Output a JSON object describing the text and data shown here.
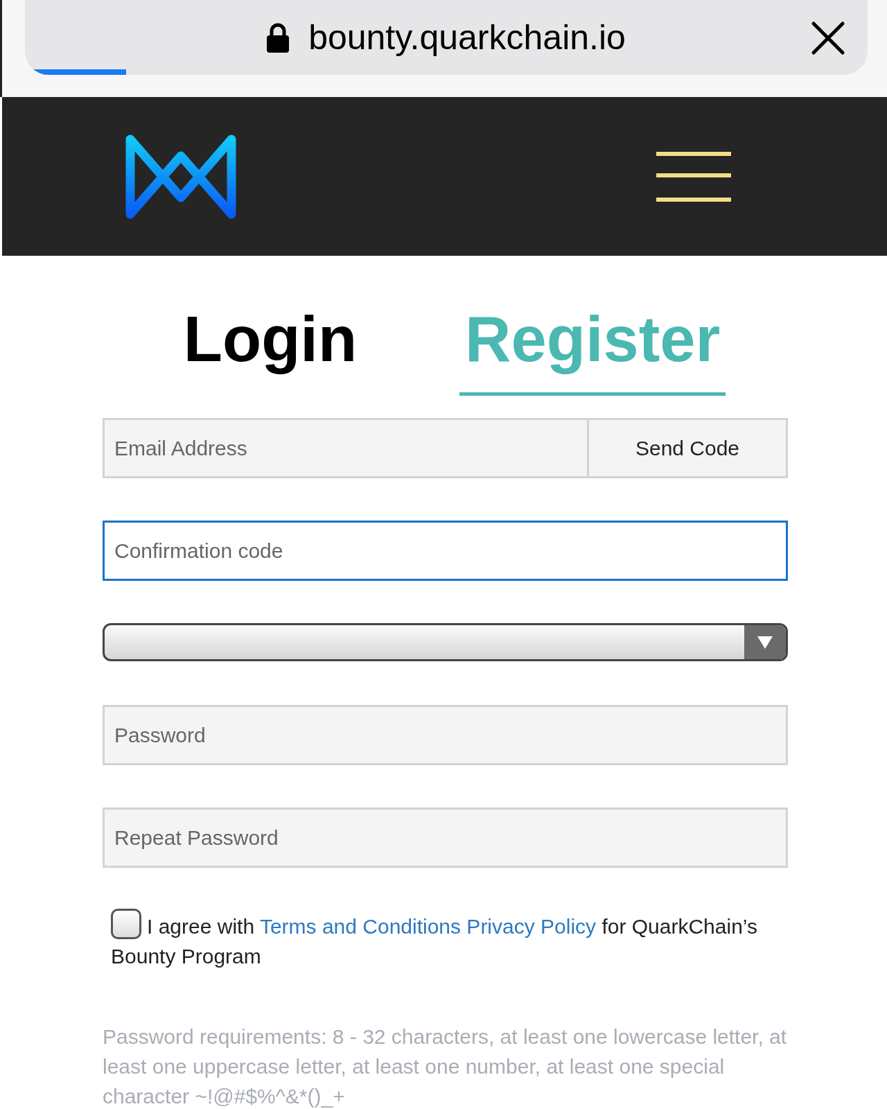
{
  "browser_bar": {
    "url": "bounty.quarkchain.io",
    "progress": {
      "level": 0.12
    }
  },
  "tabs": [
    {
      "label": "Login",
      "selected": false
    },
    {
      "label": "Register",
      "selected": true
    }
  ],
  "form": {
    "email": {
      "placeholder": "Email Address"
    },
    "send_code_button": "Send Code",
    "confirmation": {
      "placeholder": "Confirmation code",
      "focused": true
    },
    "password": {
      "placeholder": "Password"
    },
    "repeat_password": {
      "placeholder": "Repeat Password"
    },
    "agreement": {
      "checked": false,
      "before": "I agree with",
      "link": "Terms and Conditions Privacy Policy",
      "after": "for QuarkChain’s Bounty Program"
    },
    "requirements": "Password requirements: 8 - 32 characters, at least one lowercase letter, at least one uppercase letter, at least one number, at least one special character ~!@#$%^&*()_+"
  }
}
